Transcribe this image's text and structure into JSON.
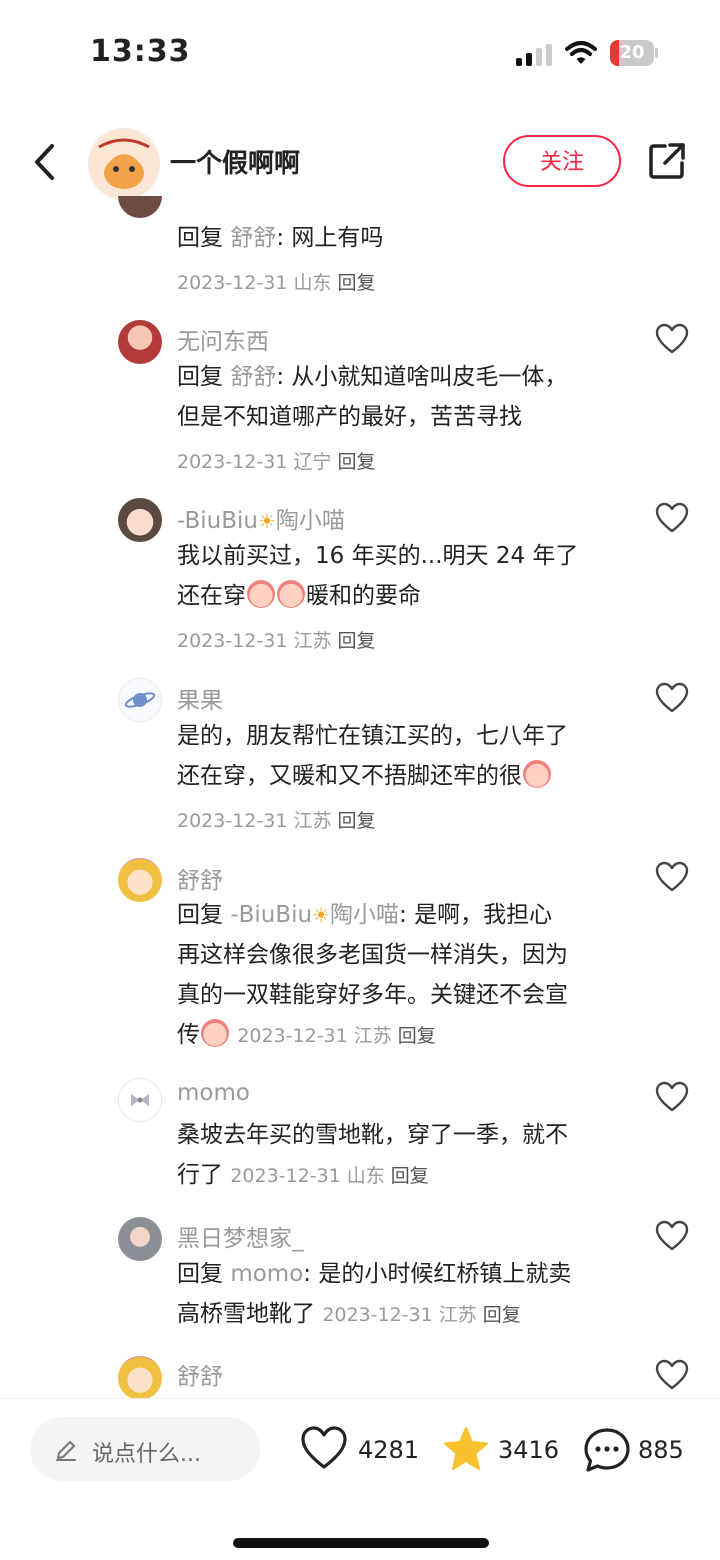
{
  "status_bar": {
    "time": "13:33",
    "battery": "20",
    "battery_level": 0.2
  },
  "header": {
    "username": "一个假啊啊",
    "follow_label": "关注"
  },
  "comments": [
    {
      "text_prefix": "回复 ",
      "reply_to": "舒舒",
      "text": ": 网上有吗",
      "date": "2023-12-31",
      "location": "山东",
      "reply_label": "回复"
    },
    {
      "username": "无问东西",
      "text_prefix": "回复 ",
      "reply_to": "舒舒",
      "line1": ": 从小就知道啥叫皮毛一体，",
      "line2": "但是不知道哪产的最好，苦苦寻找",
      "date": "2023-12-31",
      "location": "辽宁",
      "reply_label": "回复"
    },
    {
      "username_a": "-BiuBiu",
      "username_b": "陶小喵",
      "line1": "我以前买过，16 年买的...明天 24 年了",
      "line2a": "还在穿",
      "line2b": "暖和的要命",
      "date": "2023-12-31",
      "location": "江苏",
      "reply_label": "回复"
    },
    {
      "username": "果果",
      "line1": "是的，朋友帮忙在镇江买的，七八年了",
      "line2": "还在穿，又暖和又不捂脚还牢的很",
      "date": "2023-12-31",
      "location": "江苏",
      "reply_label": "回复"
    },
    {
      "username": "舒舒",
      "text_prefix": "回复 ",
      "reply_to_a": "-BiuBiu",
      "reply_to_b": "陶小喵",
      "line1": ": 是啊，我担心",
      "line2": "再这样会像很多老国货一样消失，因为",
      "line3": "真的一双鞋能穿好多年。关键还不会宣",
      "line4": "传",
      "date": "2023-12-31",
      "location": "江苏",
      "reply_label": "回复"
    },
    {
      "username": "momo",
      "line1": "桑坡去年买的雪地靴，穿了一季，就不",
      "line2": "行了",
      "date": "2023-12-31",
      "location": "山东",
      "reply_label": "回复"
    },
    {
      "username": "黑日梦想家_",
      "text_prefix": "回复 ",
      "reply_to": "momo",
      "line1": ": 是的小时候红桥镇上就卖",
      "line2": "高桥雪地靴了",
      "date": "2023-12-31",
      "location": "江苏",
      "reply_label": "回复"
    },
    {
      "username": "舒舒"
    }
  ],
  "bottom_bar": {
    "input_placeholder": "说点什么...",
    "likes": "4281",
    "stars": "3416",
    "comments": "885"
  },
  "colors": {
    "accent": "#ff2442",
    "star": "#fbc02d",
    "muted": "#9a9a9a"
  }
}
